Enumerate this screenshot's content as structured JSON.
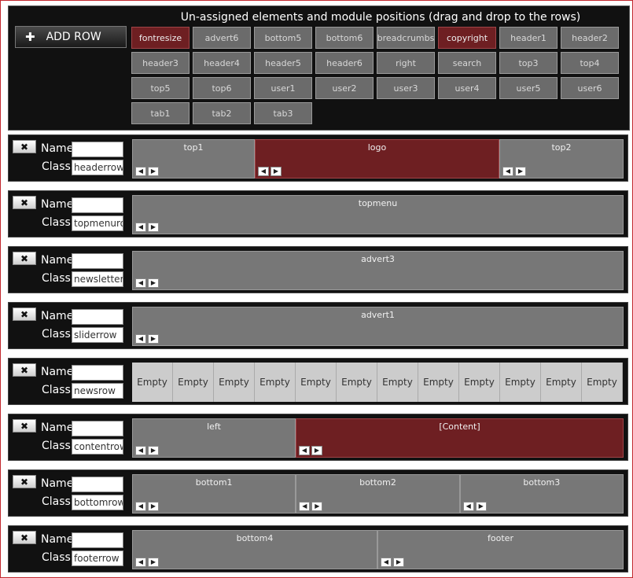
{
  "pool": {
    "title": "Un-assigned elements and module positions (drag and drop to the rows)",
    "add_row_label": "ADD ROW",
    "chips": [
      {
        "label": "fontresize",
        "red": true
      },
      {
        "label": "advert6"
      },
      {
        "label": "bottom5"
      },
      {
        "label": "bottom6"
      },
      {
        "label": "breadcrumbs"
      },
      {
        "label": "copyright",
        "red": true
      },
      {
        "label": "header1"
      },
      {
        "label": "header2"
      },
      {
        "label": "header3"
      },
      {
        "label": "header4"
      },
      {
        "label": "header5"
      },
      {
        "label": "header6"
      },
      {
        "label": "right"
      },
      {
        "label": "search"
      },
      {
        "label": "top3"
      },
      {
        "label": "top4"
      },
      {
        "label": "top5"
      },
      {
        "label": "top6"
      },
      {
        "label": "user1"
      },
      {
        "label": "user2"
      },
      {
        "label": "user3"
      },
      {
        "label": "user4"
      },
      {
        "label": "user5"
      },
      {
        "label": "user6"
      },
      {
        "label": "tab1"
      },
      {
        "label": "tab2"
      },
      {
        "label": "tab3"
      }
    ]
  },
  "labels": {
    "name": "Name",
    "class": "Class"
  },
  "rows": [
    {
      "class": "headerrow",
      "name": "",
      "slots": [
        {
          "label": "top1"
        },
        {
          "label": "logo",
          "red": true
        },
        {
          "label": "top2"
        }
      ]
    },
    {
      "class": "topmenurow",
      "name": "",
      "slots": [
        {
          "label": "topmenu"
        }
      ]
    },
    {
      "class": "newsletterrow",
      "name": "",
      "slots": [
        {
          "label": "advert3"
        }
      ]
    },
    {
      "class": "sliderrow",
      "name": "",
      "slots": [
        {
          "label": "advert1"
        }
      ]
    },
    {
      "class": "newsrow",
      "name": "",
      "empty": [
        "Empty",
        "Empty",
        "Empty",
        "Empty",
        "Empty",
        "Empty",
        "Empty",
        "Empty",
        "Empty",
        "Empty",
        "Empty",
        "Empty"
      ]
    },
    {
      "class": "contentrow",
      "name": "",
      "slots": [
        {
          "label": "left"
        },
        {
          "label": "[Content]",
          "red": true
        }
      ]
    },
    {
      "class": "bottomrow",
      "name": "",
      "slots": [
        {
          "label": "bottom1"
        },
        {
          "label": "bottom2"
        },
        {
          "label": "bottom3"
        }
      ]
    },
    {
      "class": "footerrow",
      "name": "",
      "slots": [
        {
          "label": "bottom4"
        },
        {
          "label": "footer"
        }
      ]
    }
  ]
}
